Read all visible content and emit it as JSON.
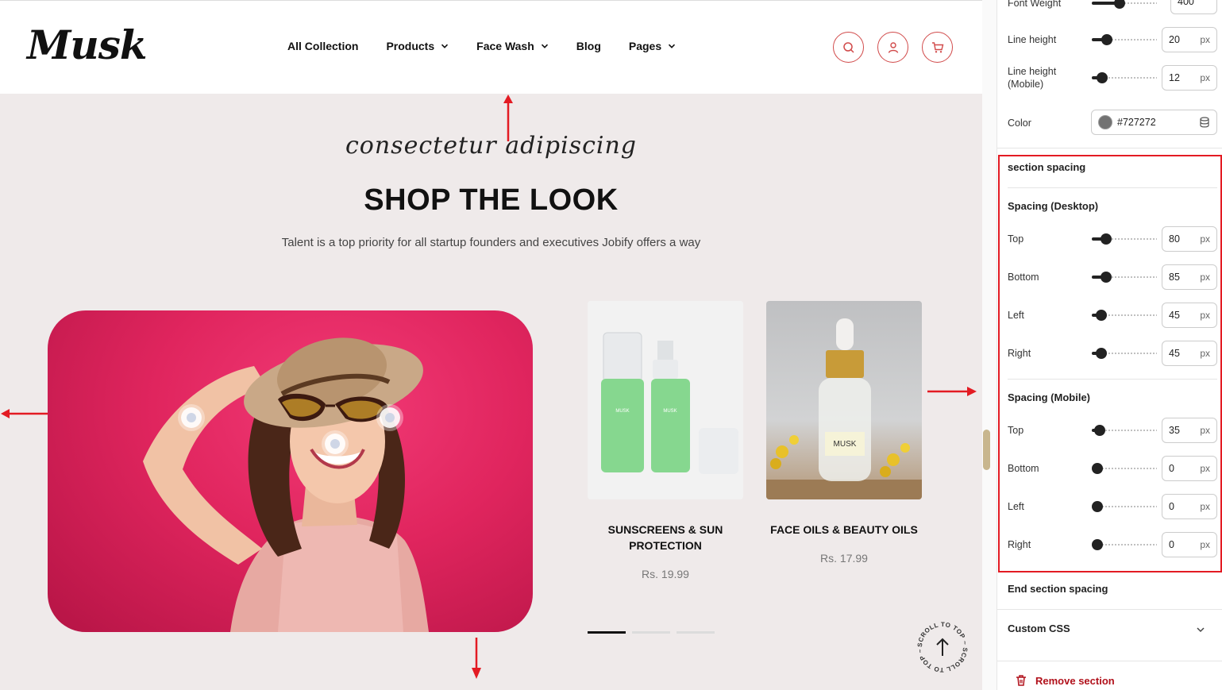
{
  "header": {
    "logo_text": "Musk",
    "nav": [
      {
        "label": "All Collection",
        "has_dropdown": false
      },
      {
        "label": "Products",
        "has_dropdown": true
      },
      {
        "label": "Face Wash",
        "has_dropdown": true
      },
      {
        "label": "Blog",
        "has_dropdown": false
      },
      {
        "label": "Pages",
        "has_dropdown": true
      }
    ],
    "icons": [
      "search-icon",
      "user-icon",
      "cart-icon"
    ],
    "accent_color": "#d14a4a"
  },
  "section": {
    "script_title": "consectetur adipiscing",
    "heading": "SHOP THE LOOK",
    "subheading": "Talent is a top priority for all startup founders and executives Jobify offers a way",
    "hero_bg_color": "#e0255e",
    "products": [
      {
        "title_line1": "SUNSCREENS & SUN",
        "title_line2": "PROTECTION",
        "price": "Rs. 19.99",
        "bottle_label": "MUSK"
      },
      {
        "title_line1": "FACE OILS & BEAUTY OILS",
        "title_line2": "",
        "price": "Rs. 17.99",
        "bottle_label": "MUSK"
      }
    ],
    "slider_dots": 3,
    "active_dot": 1,
    "scroll_top_text": "SCROLL TO TOP ~ SCROLL TO TOP ~"
  },
  "panel": {
    "font_weight": {
      "label": "Font Weight",
      "value": "400"
    },
    "line_height": {
      "label": "Line height",
      "value": "20",
      "unit": "px"
    },
    "line_height_mobile": {
      "label_line1": "Line height",
      "label_line2": "(Mobile)",
      "value": "12",
      "unit": "px"
    },
    "color": {
      "label": "Color",
      "value": "#727272"
    },
    "section_spacing_label": "section spacing",
    "desktop": {
      "heading": "Spacing (Desktop)",
      "top": {
        "label": "Top",
        "value": "80",
        "unit": "px"
      },
      "bottom": {
        "label": "Bottom",
        "value": "85",
        "unit": "px"
      },
      "left": {
        "label": "Left",
        "value": "45",
        "unit": "px"
      },
      "right": {
        "label": "Right",
        "value": "45",
        "unit": "px"
      }
    },
    "mobile": {
      "heading": "Spacing (Mobile)",
      "top": {
        "label": "Top",
        "value": "35",
        "unit": "px"
      },
      "bottom": {
        "label": "Bottom",
        "value": "0",
        "unit": "px"
      },
      "left": {
        "label": "Left",
        "value": "0",
        "unit": "px"
      },
      "right": {
        "label": "Right",
        "value": "0",
        "unit": "px"
      }
    },
    "end_section_spacing": "End section spacing",
    "custom_css": "Custom CSS",
    "remove_section": "Remove section",
    "highlight_color": "#e31b23"
  }
}
